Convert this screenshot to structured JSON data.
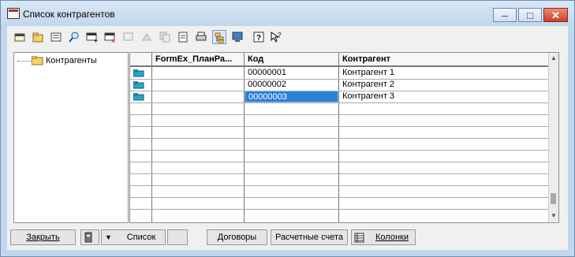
{
  "window": {
    "title": "Список контрагентов",
    "minimize_label": "‒",
    "maximize_label": "□",
    "close_label": "✕"
  },
  "toolbar": {
    "icons": [
      "new-icon",
      "folder-icon",
      "edit-icon",
      "search-icon",
      "add-row-icon",
      "delete-row-icon",
      "copy-icon",
      "move-icon",
      "properties-icon",
      "print-icon",
      "hierarchy-icon",
      "monitor-icon",
      "help-icon",
      "context-help-icon"
    ]
  },
  "tree": {
    "root_label": "Контрагенты"
  },
  "grid": {
    "columns": [
      "FormEx_ПланРа...",
      "Код",
      "Контрагент"
    ],
    "rows": [
      {
        "code": "00000001",
        "name": "Контрагент 1"
      },
      {
        "code": "00000002",
        "name": "Контрагент 2"
      },
      {
        "code": "00000003",
        "name": "Контрагент 3"
      }
    ],
    "selected_index": 2
  },
  "bottom": {
    "close_label": "Закрыть",
    "list_label": "Список",
    "contracts_label": "Договоры",
    "accounts_label": "Расчетные счета",
    "columns_label": "Колонки"
  }
}
